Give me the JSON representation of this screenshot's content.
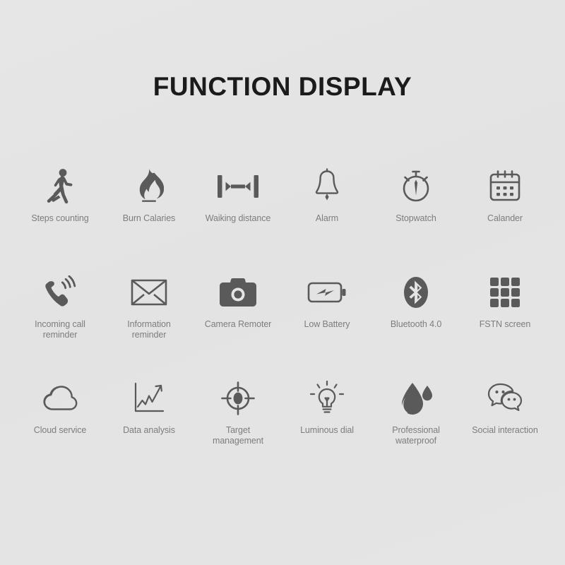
{
  "header": {
    "title": "FUNCTION DISPLAY"
  },
  "theme": {
    "background": "#e5e5e5",
    "title_color": "#1b1b1b",
    "label_color": "#7d7d7d",
    "icon_color": "#5a5a5a"
  },
  "features": [
    {
      "icon": "running-person-icon",
      "label": "Steps counting"
    },
    {
      "icon": "flame-icon",
      "label": "Burn Calaries"
    },
    {
      "icon": "distance-measure-icon",
      "label": "Waiking distance"
    },
    {
      "icon": "bell-icon",
      "label": "Alarm"
    },
    {
      "icon": "stopwatch-icon",
      "label": "Stopwatch"
    },
    {
      "icon": "calendar-icon",
      "label": "Calander"
    },
    {
      "icon": "ringing-phone-icon",
      "label": "Incoming call\nreminder"
    },
    {
      "icon": "envelope-icon",
      "label": "Information\nreminder"
    },
    {
      "icon": "camera-icon",
      "label": "Camera Remoter"
    },
    {
      "icon": "battery-bolt-icon",
      "label": "Low Battery"
    },
    {
      "icon": "bluetooth-icon",
      "label": "Bluetooth 4.0"
    },
    {
      "icon": "grid-screen-icon",
      "label": "FSTN screen"
    },
    {
      "icon": "cloud-icon",
      "label": "Cloud service"
    },
    {
      "icon": "line-chart-icon",
      "label": "Data analysis"
    },
    {
      "icon": "target-crosshair-icon",
      "label": "Target\nmanagement"
    },
    {
      "icon": "lightbulb-icon",
      "label": "Luminous dial"
    },
    {
      "icon": "water-drop-icon",
      "label": "Professional\nwaterproof"
    },
    {
      "icon": "chat-bubbles-icon",
      "label": "Social interaction"
    }
  ]
}
